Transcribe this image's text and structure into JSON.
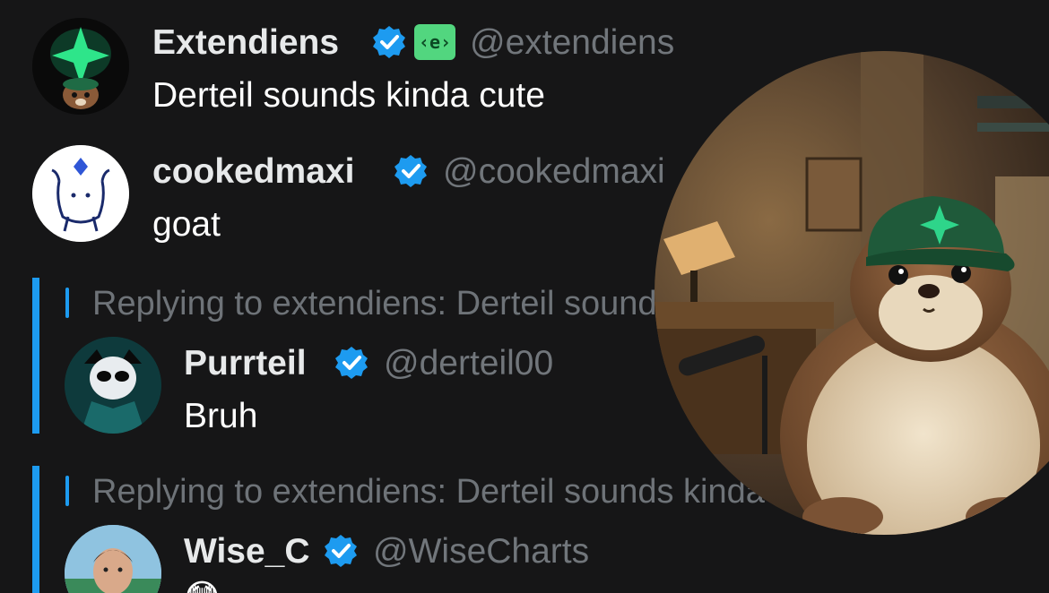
{
  "posts": [
    {
      "name": "Extendiens",
      "handle": "@extendiens",
      "badge_text": "‹e›",
      "text": "Derteil sounds kinda cute",
      "avatar": "otter-logo-avatar"
    },
    {
      "name": "cookedmaxi",
      "handle": "@cookedmaxi",
      "text": "goat",
      "avatar": "doodle-avatar"
    }
  ],
  "replies": [
    {
      "context": "Replying to extendiens: Derteil sounds kinda cute",
      "name": "Purrteil",
      "handle": "@derteil00",
      "text": "Bruh",
      "avatar": "panda-avatar"
    },
    {
      "context": "Replying to extendiens: Derteil sounds kinda cute",
      "name": "Wise_C",
      "handle": "@WiseCharts",
      "text": "😳",
      "avatar": "man-photo-avatar"
    }
  ],
  "colors": {
    "background": "#161617",
    "accent": "#1d9bf0",
    "badge": "#52d67f"
  }
}
